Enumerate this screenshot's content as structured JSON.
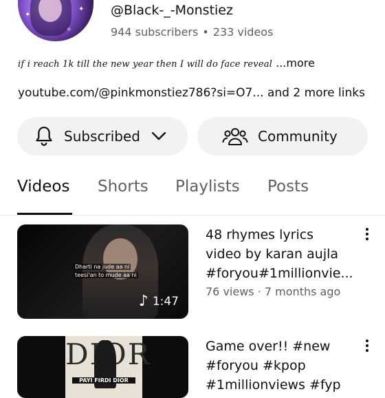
{
  "channel": {
    "handle": "@Black-_-Monstiez",
    "subscribers": "944 subscribers",
    "separator": "•",
    "videos_count": "233 videos",
    "description": "if i reach 1k till the new year then I will do face reveal",
    "more_label": "...more",
    "link_text": "youtube.com/@pinkmonstiez786?si=O7...",
    "more_links": "and 2 more links"
  },
  "actions": {
    "subscribed_label": "Subscribed",
    "community_label": "Community"
  },
  "tabs": [
    {
      "label": "Videos",
      "active": true
    },
    {
      "label": "Shorts",
      "active": false
    },
    {
      "label": "Playlists",
      "active": false
    },
    {
      "label": "Posts",
      "active": false
    }
  ],
  "videos": [
    {
      "title_lines": [
        "48 rhymes lyrics",
        "video by karan aujla",
        "#foryou#1millionvie..."
      ],
      "views": "76 views",
      "separator": "·",
      "age": "7 months ago",
      "duration": "1:47",
      "thumb_caption_1": "Dharti na jude aa ni",
      "thumb_caption_2": "teesi'an to mude aa ni"
    },
    {
      "title_lines": [
        "Game over!! #new",
        "#foryou #kpop",
        "#1millionviews #fyp"
      ],
      "thumb_brand": "DIOR",
      "thumb_tag": "PAYI FIRDI DIOR"
    }
  ],
  "icons": {
    "bell": "bell-icon",
    "chevron": "chevron-down-icon",
    "community": "people-icon",
    "more": "more-vert-icon",
    "music": "music-note-icon"
  }
}
